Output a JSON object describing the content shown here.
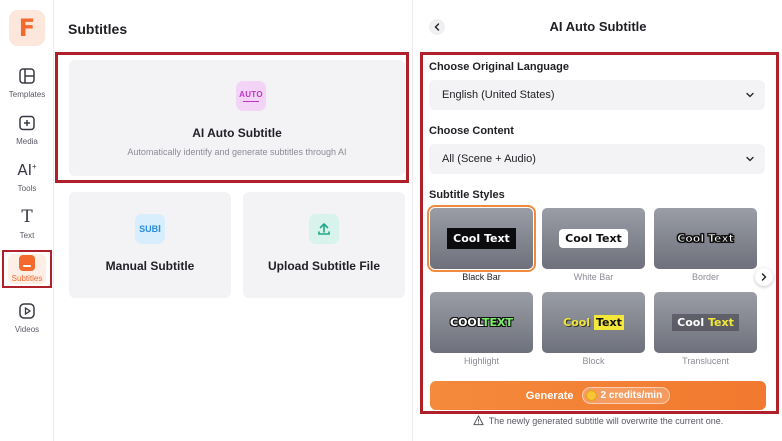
{
  "sidebar": {
    "logo_letter": "F",
    "items": [
      {
        "label": "Templates",
        "icon": "templates-icon"
      },
      {
        "label": "Media",
        "icon": "media-icon"
      },
      {
        "label": "Tools",
        "icon": "ai-tools-icon",
        "glyph": "AI"
      },
      {
        "label": "Text",
        "icon": "text-icon",
        "glyph": "T"
      },
      {
        "label": "Subtitles",
        "icon": "subtitles-icon",
        "active": true
      },
      {
        "label": "Videos",
        "icon": "videos-icon"
      }
    ]
  },
  "subtitles_panel": {
    "title": "Subtitles",
    "ai_card": {
      "badge": "AUTO",
      "title": "AI Auto Subtitle",
      "description": "Automatically identify and generate subtitles through AI"
    },
    "manual_card": {
      "badge": "SUB",
      "title": "Manual Subtitle"
    },
    "upload_card": {
      "title": "Upload Subtitle File"
    }
  },
  "ai_panel": {
    "title": "AI Auto Subtitle",
    "language": {
      "label": "Choose Original Language",
      "value": "English (United States)"
    },
    "content": {
      "label": "Choose Content",
      "value": "All (Scene + Audio)"
    },
    "styles": {
      "label": "Subtitle Styles",
      "sample_text": "Cool Text",
      "sample_upper_1": "COOL",
      "sample_upper_2": "TEXT",
      "sample_word_1": "Cool",
      "sample_word_2": "Text",
      "items": [
        {
          "name": "Black Bar",
          "selected": true
        },
        {
          "name": "White Bar"
        },
        {
          "name": "Border"
        },
        {
          "name": "Highlight"
        },
        {
          "name": "Block"
        },
        {
          "name": "Translucent"
        }
      ]
    },
    "generate": {
      "label": "Generate",
      "credits": "2 credits/min"
    },
    "note": "The newly generated subtitle will overwrite the current one."
  },
  "colors": {
    "accent": "#f26a2e",
    "highlight_frame": "#b0202a",
    "generate_button": "#f48a3c"
  }
}
